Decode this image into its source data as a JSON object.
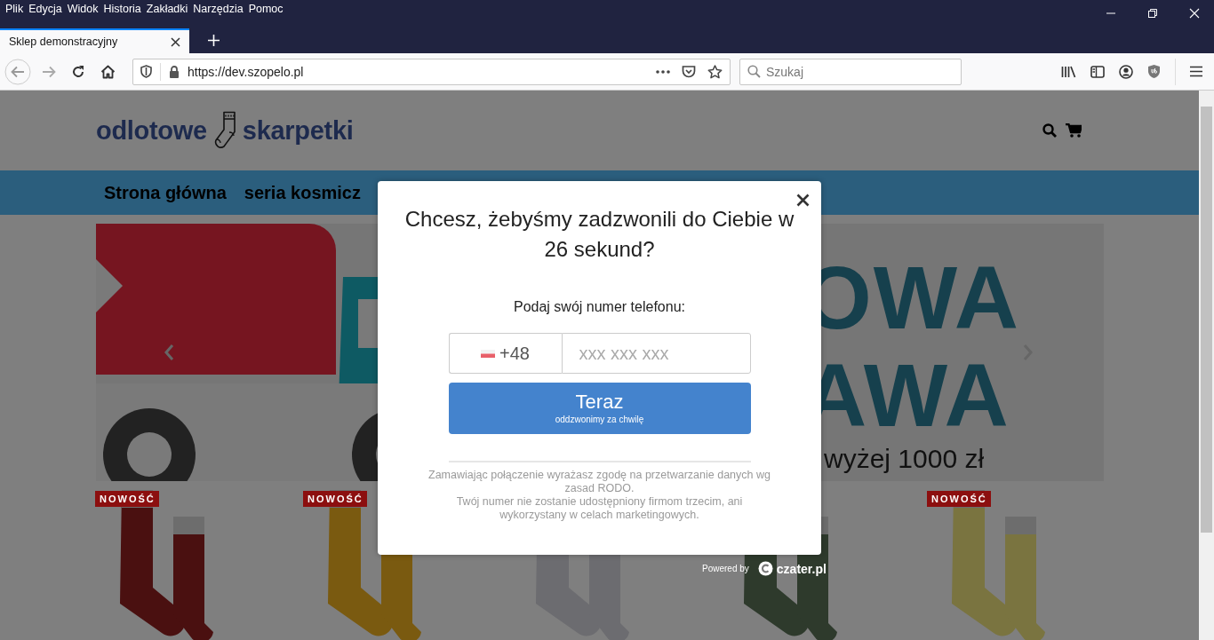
{
  "menu_bar": {
    "items": [
      "Plik",
      "Edycja",
      "Widok",
      "Historia",
      "Zakładki",
      "Narzędzia",
      "Pomoc"
    ]
  },
  "tabs": [
    {
      "label": "Sklep demonstracyjny",
      "selected": true
    }
  ],
  "toolbar": {
    "url": "https://dev.szopelo.pl",
    "search": {
      "placeholder": "Szukaj"
    }
  },
  "site": {
    "logo": {
      "left": "odlotowe",
      "right": "skarpetki"
    },
    "nav": [
      {
        "label": "Strona główna"
      },
      {
        "label": "seria kosmicz"
      }
    ],
    "banner": {
      "lines": [
        "OWA",
        "AWA"
      ],
      "note": "wyżej 1000 zł"
    },
    "products": [
      {
        "badge": "NOWOŚĆ",
        "color": "#4a1010"
      },
      {
        "badge": "NOWOŚĆ",
        "color": "#7a5a10"
      },
      {
        "color": "#6c6c70"
      },
      {
        "color": "#2e3a2c"
      },
      {
        "badge": "NOWOŚĆ",
        "color": "#7a7440"
      }
    ]
  },
  "dialog": {
    "title": "Chcesz, żebyśmy zadzwonili do Ciebie w 26 sekund?",
    "prompt": "Podaj swój numer telefonu:",
    "country_code": "+48",
    "phone": {
      "placeholder": "xxx xxx xxx"
    },
    "submit": {
      "label": "Teraz",
      "sublabel": "oddzwonimy za chwilę"
    },
    "notes": [
      "Zamawiając połączenie wyrażasz zgodę na przetwarzanie danych wg zasad RODO.",
      "Twój numer nie zostanie udostępniony firmom trzecim, ani wykorzystany w celach marketingowych."
    ],
    "powered_by": {
      "label": "Powered by",
      "brand": "czater.pl"
    }
  }
}
